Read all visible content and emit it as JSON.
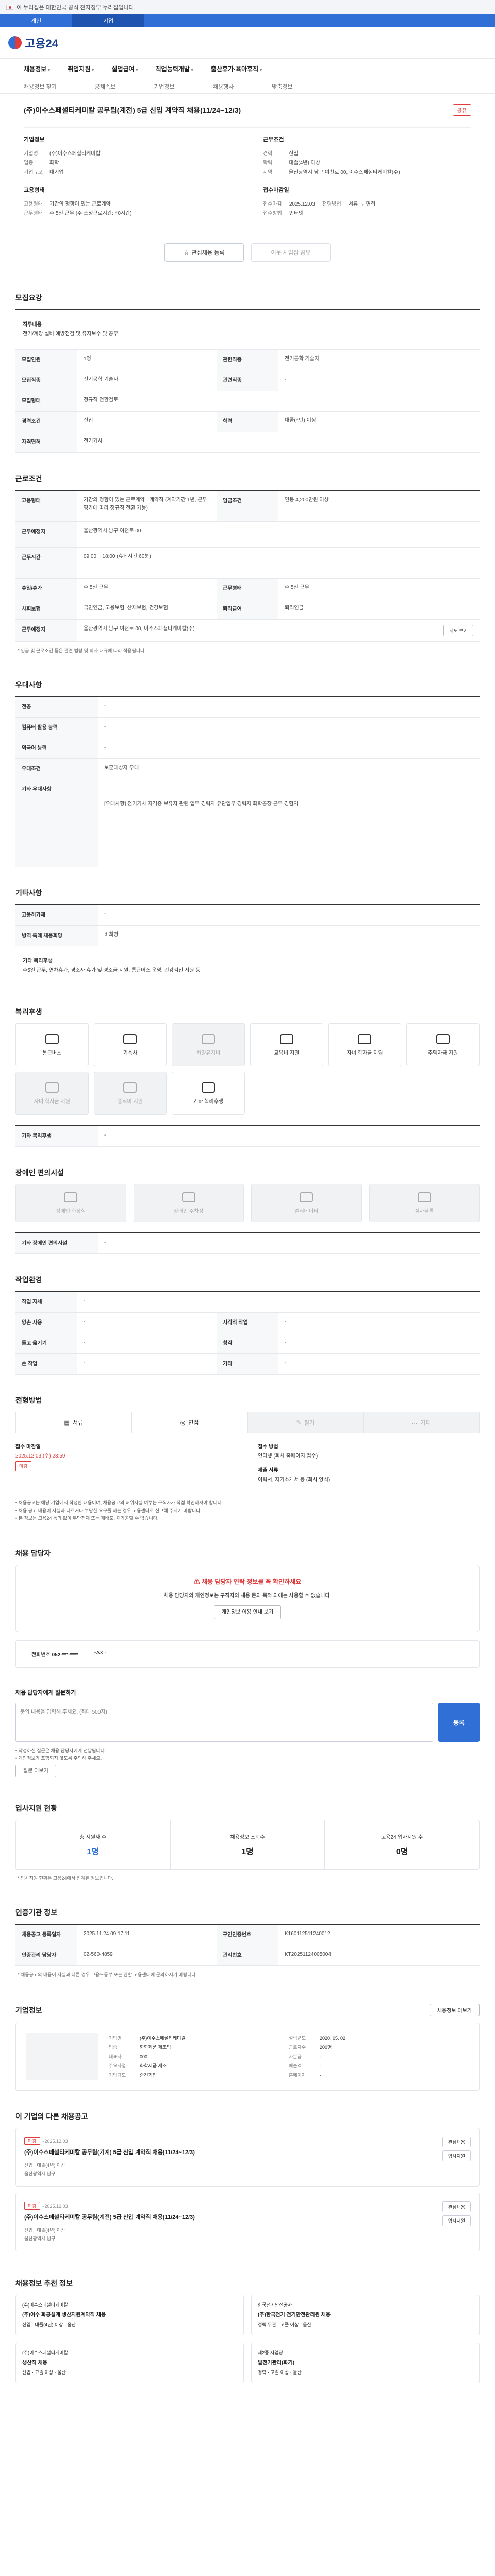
{
  "banner": {
    "text": "이 누리집은 대한민국 공식 전자정부 누리집입니다."
  },
  "top_tabs": [
    "개인",
    "기업"
  ],
  "logo": {
    "text": "고용24"
  },
  "gnb": [
    "채용정보",
    "취업지원",
    "실업급여",
    "직업능력개발",
    "출산휴가·육아휴직"
  ],
  "subnav": [
    "채용정보 찾기",
    "공채속보",
    "기업정보",
    "채용행사",
    "맞춤정보"
  ],
  "job": {
    "title": "(주)이수스페셜티케미칼 공무팀(계전) 5급 신입 계약직 채용(11/24~12/3)",
    "share": "공유",
    "company_label": "기업정보",
    "company": [
      {
        "k": "기업명",
        "v": "(주)이수스페셜티케미칼"
      },
      {
        "k": "업종",
        "v": "화학"
      },
      {
        "k": "기업규모",
        "v": "대기업"
      },
      {
        "k": "사업자",
        "v": "1234567890"
      }
    ],
    "cond_label": "근무조건",
    "cond": [
      {
        "k": "경력",
        "v": "신입"
      },
      {
        "k": "학력",
        "v": "대졸(4년) 이상"
      },
      {
        "k": "지역",
        "v": "울산광역시 남구 여천로 00, 이수스페셜티케미칼(주)"
      }
    ],
    "period_label": "고용형태",
    "period": [
      {
        "k": "고용형태",
        "v": "기간의 정함이 있는 근로계약"
      },
      {
        "k": "근무형태",
        "v": "주 5일 근무 (주 소정근로시간: 40시간)"
      }
    ],
    "apply_label": "접수마감일",
    "apply": [
      {
        "k": "접수마감",
        "v": "2025.12.03"
      },
      {
        "k": "전형방법",
        "v": "서류 → 면접"
      },
      {
        "k": "접수방법",
        "v": "인터넷"
      }
    ]
  },
  "actions": {
    "scrap": "관심채용 등록",
    "share": "이웃 사업장 공유"
  },
  "sections": {
    "recruit": {
      "title": "모집요강",
      "duty_title": "직무내용",
      "duty_text": "전기/계장 설비 예방점검 및 유지보수 및 공무",
      "rows": [
        {
          "k": "모집인원",
          "v": "1명",
          "k2": "관련직종",
          "v2": "전기공학 기술자"
        },
        {
          "k": "모집직종",
          "v": "전기공학 기술자",
          "k2": "관련직종",
          "v2": "-"
        },
        {
          "k": "모집형태",
          "v": "정규직 전환검토",
          "k2": "",
          "v2": ""
        },
        {
          "k": "경력조건",
          "v": "신입",
          "k2": "학력",
          "v2": "대졸(4년) 이상"
        },
        {
          "k": "자격면허",
          "v": "전기기사",
          "k2": "",
          "v2": ""
        }
      ]
    },
    "conditions": {
      "title": "근로조건",
      "rows": [
        {
          "k": "고용형태",
          "v": "기간의 정함이 있는 근로계약 · 계약직 (계약기간 1년, 근무평가에 따라 정규직 전환 가능)",
          "k2": "임금조건",
          "v2": "연봉 4,200만원 이상"
        },
        {
          "k": "근무예정지",
          "v": "울산광역시 남구 여천로 00",
          "k2": "",
          "v2": ""
        },
        {
          "k": "근무시간",
          "v": "09:00 ~ 18:00 (휴게시간 60분)",
          "k2": "",
          "v2": ""
        },
        {
          "k": "휴일/휴가",
          "v": "주 5일 근무",
          "k2": "근무형태",
          "v2": "주 5일 근무"
        },
        {
          "k": "사회보험",
          "v": "국민연금, 고용보험, 산재보험, 건강보험",
          "k2": "퇴직급여",
          "v2": "퇴직연금"
        },
        {
          "k": "근무예정지",
          "v": "울산광역시 남구 여천로 00, 이수스페셜티케미칼(주)",
          "k2": "",
          "v2": ""
        }
      ],
      "map_btn": "지도 보기",
      "note": "* 임금 및 근로조건 등은 관련 법령 및 회사 내규에 따라 적용됩니다."
    },
    "prefer": {
      "title": "우대사항",
      "rows": [
        {
          "k": "전공",
          "v": "-"
        },
        {
          "k": "컴퓨터 활용 능력",
          "v": "-"
        },
        {
          "k": "외국어 능력",
          "v": "-"
        },
        {
          "k": "우대조건",
          "v": "보훈대상자 우대"
        },
        {
          "k": "기타 우대사항",
          "v": "[우대사항] 전기기사 자격증 보유자 관련 업무 경력자 유관업무 경력자 화학공장 근무 경험자"
        }
      ]
    },
    "etc": {
      "title": "기타사항",
      "rows": [
        {
          "k": "고용허가제",
          "v": "-"
        },
        {
          "k": "병역 특례 채용희망",
          "v": "비희망"
        }
      ],
      "box_title": "기타 복리후생",
      "box_text": "주5일 근무, 연차휴가, 경조사 휴가 및 경조금 지원, 통근버스 운영, 건강검진 지원 등"
    },
    "welfare": {
      "title": "복리후생",
      "items": [
        {
          "label": "통근버스",
          "on": true
        },
        {
          "label": "기숙사",
          "on": true
        },
        {
          "label": "차량유지비",
          "on": false
        },
        {
          "label": "교육비 지원",
          "on": true
        },
        {
          "label": "자녀 학자금 지원",
          "on": true
        },
        {
          "label": "주택자금 지원",
          "on": true
        },
        {
          "label": "자녀 학자금 지원",
          "on": false
        },
        {
          "label": "중식비 지원",
          "on": false
        },
        {
          "label": "기타 복리후생",
          "on": true
        }
      ],
      "etc_label": "기타 복리후생",
      "etc_value": "-"
    },
    "disabled": {
      "title": "장애인 편의시설",
      "items": [
        "장애인 화장실",
        "장애인 주차장",
        "엘리베이터",
        "점자블록"
      ],
      "etc_label": "기타 장애인 편의시설",
      "etc_value": "-"
    },
    "work_env": {
      "title": "작업환경",
      "rows": [
        {
          "k": "작업 자세",
          "v": "-"
        },
        {
          "k": "양손 사용",
          "v": "-",
          "k2": "시각적 작업",
          "v2": "-"
        },
        {
          "k": "들고 옮기기",
          "v": "-",
          "k2": "청각",
          "v2": "-"
        },
        {
          "k": "손 작업",
          "v": "-",
          "k2": "기타",
          "v2": "-"
        }
      ]
    },
    "process": {
      "title": "전형방법",
      "steps": [
        {
          "label": "서류",
          "on": true
        },
        {
          "label": "면접",
          "on": true
        },
        {
          "label": "필기",
          "on": false
        },
        {
          "label": "기타",
          "on": false
        }
      ],
      "deadline_label": "접수 마감일",
      "deadline": "2025.12.03 (수) 23:59",
      "deadline_tag": "마감",
      "method_label": "접수 방법",
      "method": "인터넷 (회사 홈페이지 접수)",
      "doc_label": "제출 서류",
      "doc": "이력서, 자기소개서 등 (회사 양식)",
      "bullets": [
        "• 채용공고는 해당 기업에서 작성한 내용이며, 채용공고의 허위사실 여부는 구직자가 직접 확인하셔야 합니다.",
        "• 채용 공고 내용이 사실과 다르거나 부당한 요구를 하는 경우 고용센터로 신고해 주시기 바랍니다.",
        "• 본 정보는 고용24 동의 없이 무단전재 또는 재배포, 재가공할 수 없습니다."
      ]
    },
    "contact": {
      "title": "채용 담당자",
      "warn_title": "채용 담당자 연락 정보를 꼭 확인하세요",
      "warn_text": "채용 담당자의 개인정보는 구직자의 채용 문의 목적 외에는 사용할 수 없습니다.",
      "warn_btn": "개인정보 이용 안내 보기",
      "phone_label": "전화번호",
      "phone": "052-***-****",
      "fax_label": "FAX",
      "fax": "-"
    },
    "review": {
      "title": "채용 담당자에게 질문하기",
      "placeholder": "문의 내용을 입력해 주세요. (최대 500자)",
      "register": "등록",
      "notes": [
        "• 작성하신 질문은 채용 담당자에게 전달됩니다.",
        "• 개인정보가 포함되지 않도록 주의해 주세요."
      ],
      "more_btn": "질문 더보기"
    },
    "stats": {
      "title": "입사지원 현황",
      "items": [
        {
          "label": "총 지원자 수",
          "value": "1명",
          "blue": true
        },
        {
          "label": "채용정보 조회수",
          "value": "1명",
          "blue": false
        },
        {
          "label": "고용24 입사지원 수",
          "value": "0명",
          "blue": false
        }
      ],
      "note": "* 입사지원 현황은 고용24에서 집계된 정보입니다."
    },
    "info": {
      "title": "인증기관 정보",
      "rows": [
        {
          "k": "채용공고 등록일자",
          "v": "2025.11.24 09:17:11",
          "k2": "구인인증번호",
          "v2": "K160112511240012"
        },
        {
          "k": "인증관리 담당자",
          "v": "02-560-4859",
          "k2": "관리번호",
          "v2": "KT20251124005004"
        }
      ],
      "note": "* 채용공고의 내용이 사실과 다른 경우 고용노동부 또는 관할 고용센터에 문의하시기 바랍니다."
    },
    "company": {
      "title": "기업정보",
      "more": "채용정보 더보기",
      "rows": [
        {
          "k": "기업명",
          "v": "(주)이수스페셜티케미칼",
          "k2": "설립년도",
          "v2": "2020. 05. 02"
        },
        {
          "k": "업종",
          "v": "화학제품 제조업",
          "k2": "근로자수",
          "v2": "200명"
        },
        {
          "k": "대표자",
          "v": "000",
          "k2": "자본금",
          "v2": "-"
        },
        {
          "k": "주요사업",
          "v": "화학제품 제조",
          "k2": "매출액",
          "v2": "-"
        },
        {
          "k": "기업규모",
          "v": "중견기업",
          "k2": "홈페이지",
          "v2": "-"
        }
      ]
    },
    "company_jobs": {
      "title": "이 기업의 다른 채용공고",
      "cards": [
        {
          "tag": "마감",
          "date": "~2025.12.03",
          "title": "(주)이수스페셜티케미칼 공무팀(기계) 5급 신입 계약직 채용(11/24~12/3)",
          "meta1": "신입 · 대졸(4년) 이상",
          "meta2": "울산광역시 남구",
          "btn1": "관심채용",
          "btn2": "입사지원"
        },
        {
          "tag": "마감",
          "date": "~2025.12.03",
          "title": "(주)이수스페셜티케미칼 공무팀(계전) 5급 신입 계약직 채용(11/24~12/3)",
          "meta1": "신입 · 대졸(4년) 이상",
          "meta2": "울산광역시 남구",
          "btn1": "관심채용",
          "btn2": "입사지원"
        }
      ]
    },
    "similar": {
      "title": "채용정보 추천 정보",
      "cards": [
        {
          "co": "(주)이수스페셜티케미칼",
          "title": "(주)이수 화공설계 생산지원계약직 채용",
          "meta": "신입 · 대졸(4년) 이상 · 울산"
        },
        {
          "co": "한국전기안전공사",
          "title": "(주)한국전기 전기안전관리원 채용",
          "meta": "경력 무관 · 고졸 이상 · 울산"
        },
        {
          "co": "(주)이수스페셜티케미칼",
          "title": "생산직 채용",
          "meta": "신입 · 고졸 이상 · 울산"
        },
        {
          "co": "제2종 사업장",
          "title": "발전기관리(화기)",
          "meta": "경력 · 고졸 이상 · 울산"
        }
      ]
    }
  }
}
